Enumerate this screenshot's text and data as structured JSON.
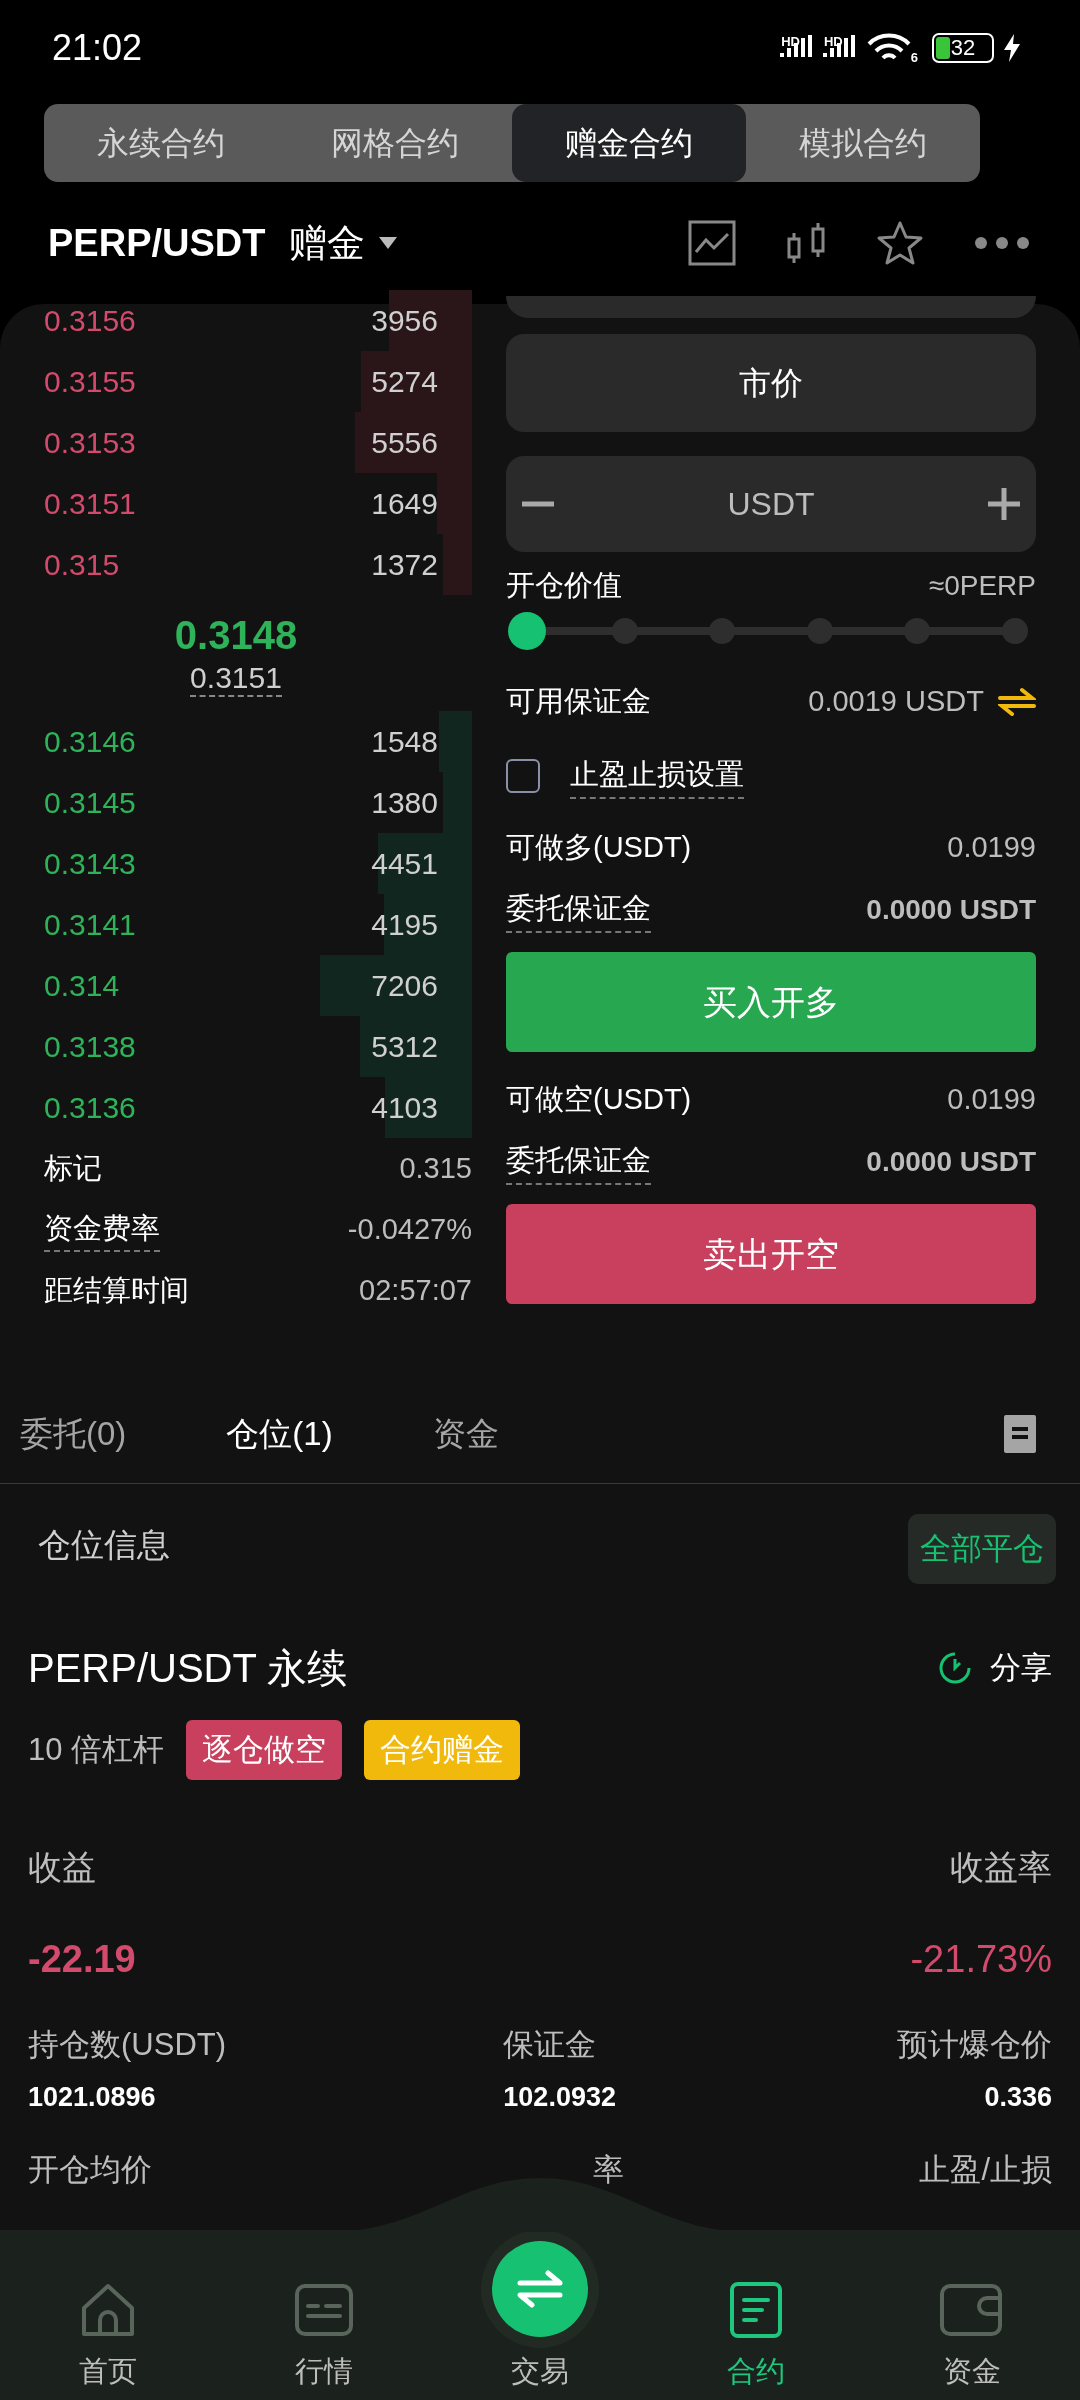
{
  "status_bar": {
    "time": "21:02",
    "signals": [
      "HD",
      "HD"
    ],
    "wifi_badge": "6",
    "battery": "32"
  },
  "mode_tabs": [
    {
      "label": "永续合约",
      "selected": false
    },
    {
      "label": "网格合约",
      "selected": false
    },
    {
      "label": "赠金合约",
      "selected": true
    },
    {
      "label": "模拟合约",
      "selected": false
    }
  ],
  "header": {
    "pair": "PERP/USDT",
    "variant": "赠金"
  },
  "order_book": {
    "asks": [
      {
        "price": "0.3156",
        "amount": "3956"
      },
      {
        "price": "0.3155",
        "amount": "5274"
      },
      {
        "price": "0.3153",
        "amount": "5556"
      },
      {
        "price": "0.3151",
        "amount": "1649"
      },
      {
        "price": "0.315",
        "amount": "1372"
      }
    ],
    "last_price": "0.3148",
    "mark_price": "0.3151",
    "bids": [
      {
        "price": "0.3146",
        "amount": "1548"
      },
      {
        "price": "0.3145",
        "amount": "1380"
      },
      {
        "price": "0.3143",
        "amount": "4451"
      },
      {
        "price": "0.3141",
        "amount": "4195"
      },
      {
        "price": "0.314",
        "amount": "7206"
      },
      {
        "price": "0.3138",
        "amount": "5312"
      },
      {
        "price": "0.3136",
        "amount": "4103"
      }
    ],
    "stats": [
      {
        "label": "标记",
        "value": "0.315",
        "dotted": false
      },
      {
        "label": "资金费率",
        "value": "-0.0427%",
        "dotted": true
      },
      {
        "label": "距结算时间",
        "value": "02:57:07",
        "dotted": false
      }
    ]
  },
  "order_form": {
    "order_type": "市价",
    "amount_placeholder": "USDT",
    "value_label": "开仓价值",
    "value_reading": "≈0PERP",
    "slider": {
      "level": 0
    },
    "available": {
      "label": "可用保证金",
      "value": "0.0019 USDT"
    },
    "tp_sl": {
      "label": "止盈止损设置",
      "checked": false
    },
    "sides": [
      {
        "kind": "long",
        "max_label": "可做多(USDT)",
        "max_value": "0.0199",
        "margin_label": "委托保证金",
        "margin_value": "0.0000 USDT",
        "button": "买入开多"
      },
      {
        "kind": "short",
        "max_label": "可做空(USDT)",
        "max_value": "0.0199",
        "margin_label": "委托保证金",
        "margin_value": "0.0000 USDT",
        "button": "卖出开空"
      }
    ]
  },
  "position_tabs": [
    {
      "label": "委托(0)",
      "selected": false
    },
    {
      "label": "仓位(1)",
      "selected": true
    },
    {
      "label": "资金",
      "selected": false
    }
  ],
  "position": {
    "section_title": "仓位信息",
    "close_all": "全部平仓",
    "symbol": "PERP/USDT 永续",
    "share": "分享",
    "leverage": "10 倍杠杆",
    "tags": [
      {
        "label": "逐仓做空",
        "color": "#c9405f"
      },
      {
        "label": "合约赠金",
        "color": "#f0b90b"
      }
    ],
    "pnl_label": "收益",
    "pnl_rate_label": "收益率",
    "pnl": "-22.19",
    "pnl_rate": "-21.73%",
    "fields": [
      {
        "label": "持仓数(USDT)",
        "value": "1021.0896"
      },
      {
        "label": "保证金",
        "value": "102.0932"
      },
      {
        "label": "预计爆仓价",
        "value": "0.336"
      }
    ],
    "next_row": [
      "开仓均价",
      "率",
      "止盈/止损"
    ]
  },
  "bottom_nav": [
    {
      "kind": "home",
      "label": "首页",
      "selected": false
    },
    {
      "kind": "market",
      "label": "行情",
      "selected": false
    },
    {
      "kind": "trade",
      "label": "交易",
      "selected": false
    },
    {
      "kind": "contract",
      "label": "合约",
      "selected": true
    },
    {
      "kind": "wallet",
      "label": "资金",
      "selected": false
    }
  ]
}
